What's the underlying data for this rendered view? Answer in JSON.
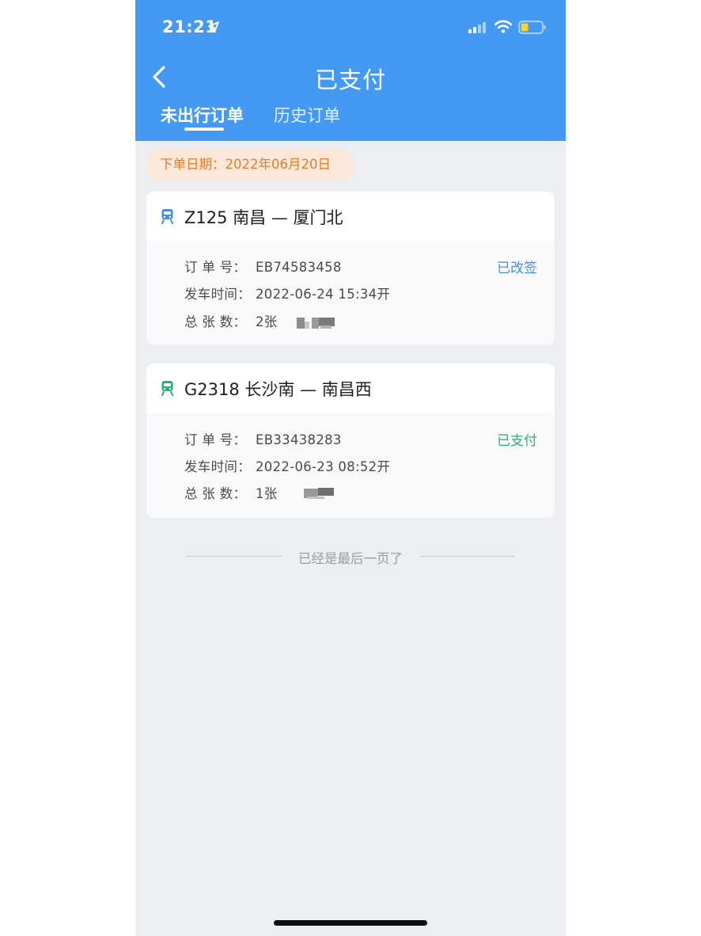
{
  "status_bar": {
    "time": "21:21"
  },
  "header": {
    "title": "已支付",
    "tabs": [
      {
        "label": "未出行订单",
        "active": true
      },
      {
        "label": "历史订单",
        "active": false
      }
    ]
  },
  "order_date": "下单日期：2022年06月20日",
  "orders": [
    {
      "route": "Z125  南昌 — 厦门北",
      "icon_color": "#3d8fe6",
      "order_no_label": "订 单 号：",
      "order_no": "EB74583458",
      "depart_label": "发车时间：",
      "depart_time": "2022-06-24   15:34开",
      "count_label": "总 张 数：",
      "count": "2张",
      "status": "已改签",
      "status_color": "#3d8fe6"
    },
    {
      "route": "G2318  长沙南 — 南昌西",
      "icon_color": "#27b07a",
      "order_no_label": "订 单 号：",
      "order_no": "EB33438283",
      "depart_label": "发车时间：",
      "depart_time": "2022-06-23   08:52开",
      "count_label": "总 张 数：",
      "count": "1张",
      "status": "已支付",
      "status_color": "#27b07a"
    }
  ],
  "footer": {
    "end_text": "已经是最后一页了"
  },
  "colors": {
    "header_bg": "#4499f2",
    "page_bg": "#edeef2",
    "date_pill_bg": "#fbe8d8",
    "date_pill_text": "#e07f2d"
  }
}
